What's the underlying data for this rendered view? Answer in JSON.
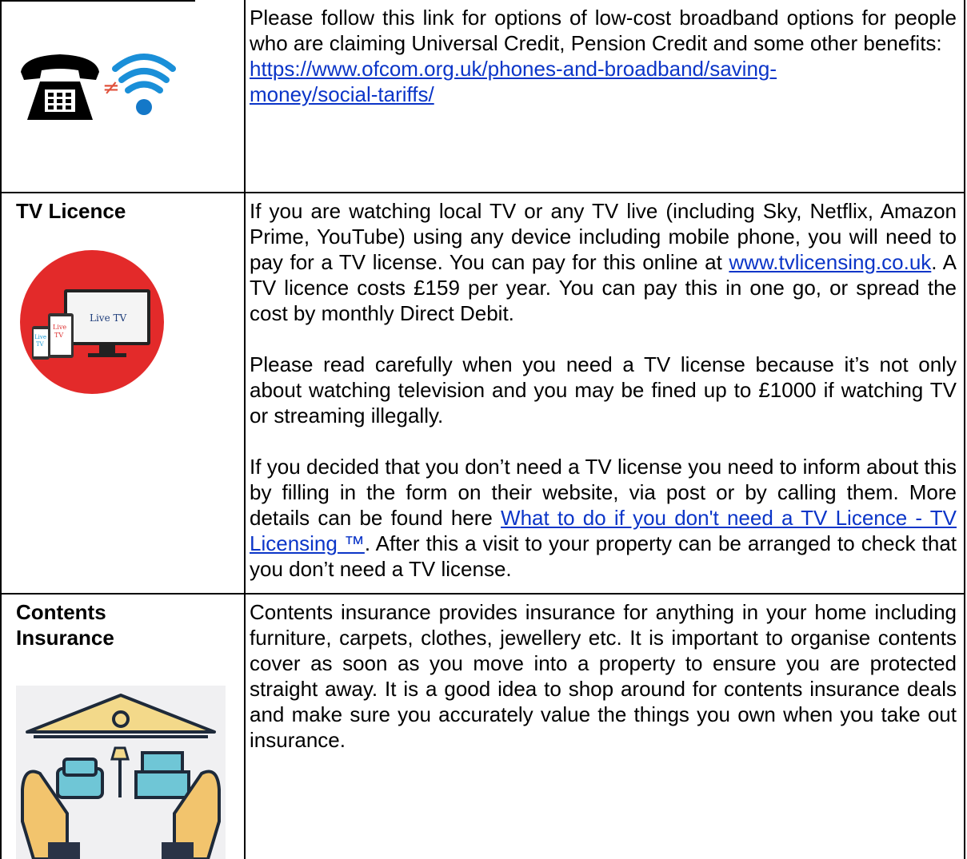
{
  "row1": {
    "text": "Please follow this link for options of low-cost broadband options for people who are claiming Universal Credit, Pension Credit and some other benefits:",
    "link_line1": "https://www.ofcom.org.uk/phones-and-broadband/saving-",
    "link_line2": "money/social-tariffs/",
    "icons": [
      "telephone-icon",
      "not-equal-icon",
      "wifi-icon"
    ],
    "not_equal": "≠"
  },
  "row2": {
    "label": "TV Licence",
    "image_text": {
      "main": "Live TV",
      "tablet": "Live TV",
      "phone": "Live TV"
    },
    "p1_before": "If you are watching local TV or any TV live (including Sky, Netflix, Amazon Prime, YouTube) using any device including mobile phone, you will need to pay for a TV license. You can pay for this online at ",
    "p1_link": "www.tvlicensing.co.uk",
    "p1_after": ". A TV licence costs £159 per year. You can pay this in one go, or spread the cost by monthly Direct Debit.",
    "p2": "Please read carefully when you need a TV license because it’s not only about watching television and you may be fined up to £1000 if watching TV or streaming illegally.",
    "p3_before": "If you decided that you don’t need a TV license you need to inform about this by filling in the form on their website, via post or by calling them. More details can be found here ",
    "p3_link": "What to do if you don't need a TV Licence - TV Licensing ™",
    "p3_after": ". After this a visit to your property can be arranged to check that you don’t need a TV license."
  },
  "row3": {
    "label_line1": "Contents",
    "label_line2": "Insurance",
    "text": "Contents insurance provides insurance for anything in your home including furniture, carpets, clothes, jewellery etc. It is important to organise contents cover as soon as you move into a property to ensure you are protected straight away. It is a good idea to shop around for contents insurance deals and make sure you accurately value the things you own when you take out insurance."
  },
  "colors": {
    "link": "#0b35c8",
    "tv_circle": "#e32a2a",
    "house_roof": "#f3d98a",
    "hands": "#f2c46d",
    "sofa": "#6fc6d6"
  }
}
